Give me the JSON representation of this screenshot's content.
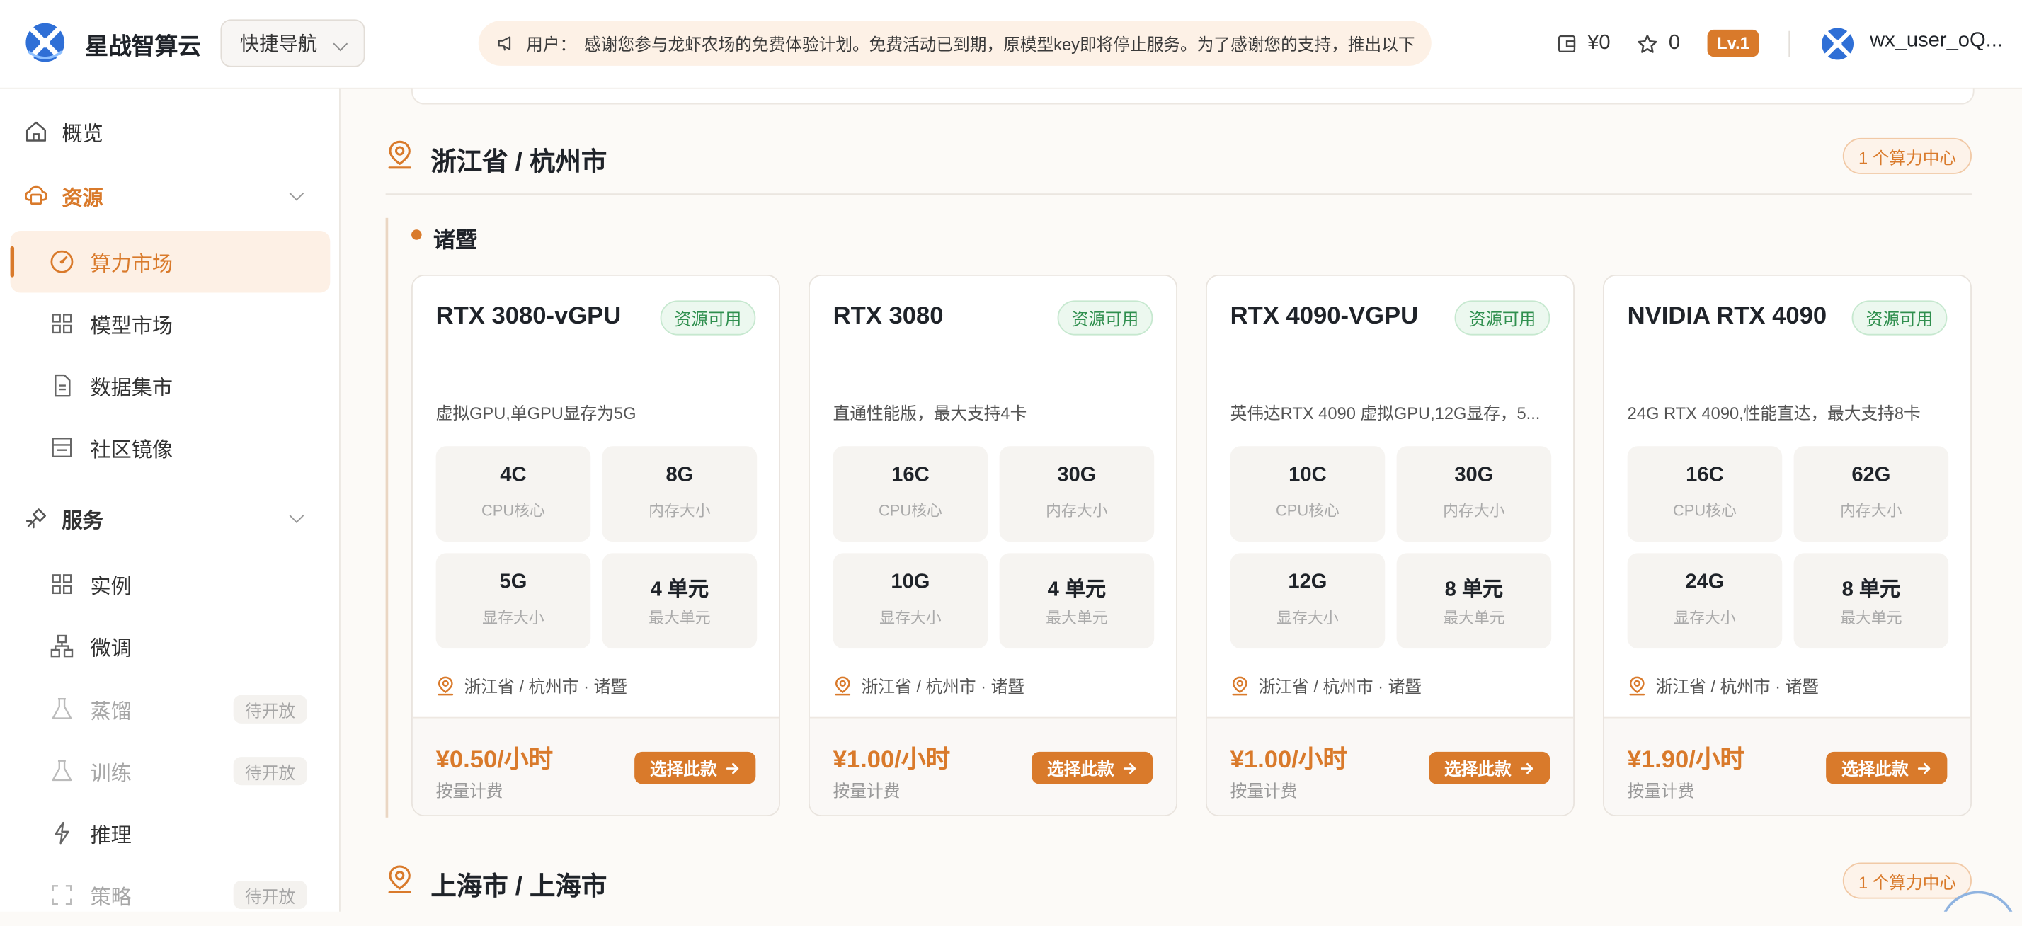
{
  "app": {
    "brand": "星战智算云"
  },
  "header": {
    "quick_nav": "快捷导航",
    "notice_prefix": "用户：",
    "notice_text": "感谢您参与龙虾农场的免费体验计划。免费活动已到期，原模型key即将停止服务。为了感谢您的支持，推出以下",
    "balance": "¥0",
    "stars": "0",
    "level": "Lv.1",
    "username": "wx_user_oQ..."
  },
  "sidebar": {
    "overview": "概览",
    "resources_group": "资源",
    "resources": [
      {
        "label": "算力市场",
        "icon": "gauge-icon",
        "active": true
      },
      {
        "label": "模型市场",
        "icon": "grid-icon"
      },
      {
        "label": "数据集市",
        "icon": "document-icon"
      },
      {
        "label": "社区镜像",
        "icon": "image-box-icon"
      }
    ],
    "services_group": "服务",
    "services": [
      {
        "label": "实例",
        "icon": "grid-icon"
      },
      {
        "label": "微调",
        "icon": "network-icon"
      },
      {
        "label": "蒸馏",
        "icon": "flask-icon",
        "badge": "待开放"
      },
      {
        "label": "训练",
        "icon": "flask-icon",
        "badge": "待开放"
      },
      {
        "label": "推理",
        "icon": "bolt-icon"
      },
      {
        "label": "策略",
        "icon": "frame-icon",
        "badge": "待开放"
      }
    ]
  },
  "regions": [
    {
      "title": "浙江省 / 杭州市",
      "count": "1 个算力中心",
      "city": "诸暨",
      "cards": [
        {
          "name": "RTX 3080-vGPU",
          "status": "资源可用",
          "desc": "虚拟GPU,单GPU显存为5G",
          "cpu": "4C",
          "cpu_label": "CPU核心",
          "mem": "8G",
          "mem_label": "内存大小",
          "vram": "5G",
          "vram_label": "显存大小",
          "units": "4 单元",
          "units_label": "最大单元",
          "location": "浙江省 / 杭州市 · 诸暨",
          "price": "¥0.50/小时",
          "billing": "按量计费",
          "button": "选择此款"
        },
        {
          "name": "RTX 3080",
          "status": "资源可用",
          "desc": "直通性能版，最大支持4卡",
          "cpu": "16C",
          "cpu_label": "CPU核心",
          "mem": "30G",
          "mem_label": "内存大小",
          "vram": "10G",
          "vram_label": "显存大小",
          "units": "4 单元",
          "units_label": "最大单元",
          "location": "浙江省 / 杭州市 · 诸暨",
          "price": "¥1.00/小时",
          "billing": "按量计费",
          "button": "选择此款"
        },
        {
          "name": "RTX 4090-VGPU",
          "status": "资源可用",
          "desc": "英伟达RTX 4090 虚拟GPU,12G显存，5...",
          "cpu": "10C",
          "cpu_label": "CPU核心",
          "mem": "30G",
          "mem_label": "内存大小",
          "vram": "12G",
          "vram_label": "显存大小",
          "units": "8 单元",
          "units_label": "最大单元",
          "location": "浙江省 / 杭州市 · 诸暨",
          "price": "¥1.00/小时",
          "billing": "按量计费",
          "button": "选择此款"
        },
        {
          "name": "NVIDIA RTX 4090",
          "status": "资源可用",
          "desc": "24G RTX 4090,性能直达，最大支持8卡",
          "cpu": "16C",
          "cpu_label": "CPU核心",
          "mem": "62G",
          "mem_label": "内存大小",
          "vram": "24G",
          "vram_label": "显存大小",
          "units": "8 单元",
          "units_label": "最大单元",
          "location": "浙江省 / 杭州市 · 诸暨",
          "price": "¥1.90/小时",
          "billing": "按量计费",
          "button": "选择此款"
        }
      ]
    },
    {
      "title": "上海市 / 上海市",
      "count": "1 个算力中心"
    }
  ],
  "colors": {
    "accent": "#d97a2b",
    "success": "#2f8f4e",
    "logo_blue": "#2f6fd6"
  }
}
